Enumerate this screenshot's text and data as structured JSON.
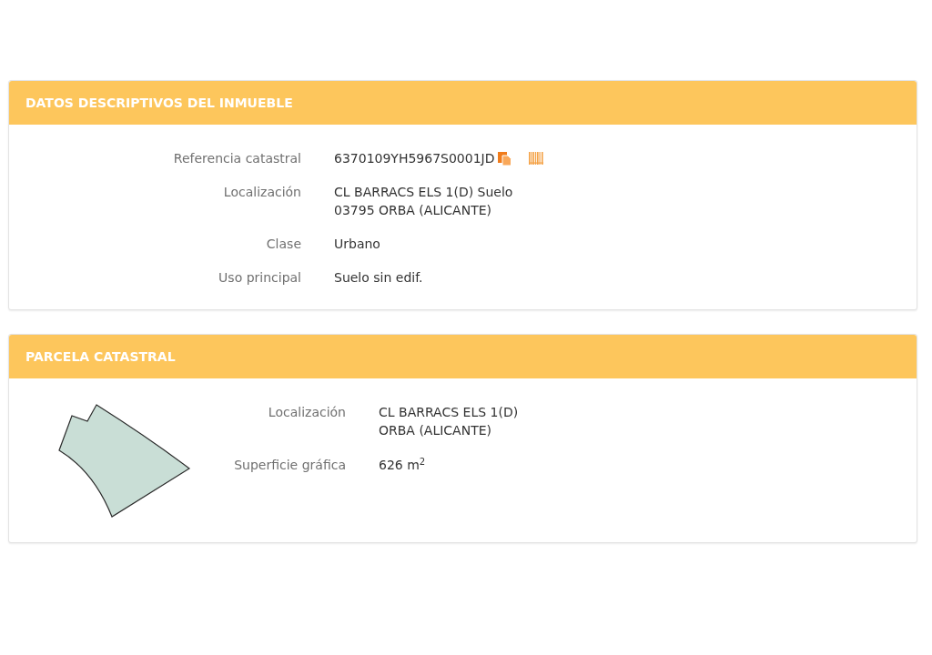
{
  "sections": [
    {
      "kind": "details",
      "title": "DATOS DESCRIPTIVOS DEL INMUEBLE",
      "fields": [
        {
          "kind": "reference",
          "label": "Referencia catastral",
          "lines": [
            "6370109YH5967S0001JD"
          ]
        },
        {
          "kind": "text",
          "label": "Localización",
          "lines": [
            "CL BARRACS ELS 1(D) Suelo",
            "03795 ORBA (ALICANTE)"
          ]
        },
        {
          "kind": "text",
          "label": "Clase",
          "lines": [
            "Urbano"
          ]
        },
        {
          "kind": "text",
          "label": "Uso principal",
          "lines": [
            "Suelo sin edif."
          ]
        }
      ]
    },
    {
      "kind": "parcel",
      "title": "PARCELA CATASTRAL",
      "fields": [
        {
          "kind": "text",
          "label": "Localización",
          "lines": [
            "CL BARRACS ELS 1(D)",
            "ORBA (ALICANTE)"
          ]
        },
        {
          "kind": "text",
          "label": "Superficie gráfica",
          "lines": [
            "626 m$^{2}$"
          ]
        }
      ]
    }
  ]
}
